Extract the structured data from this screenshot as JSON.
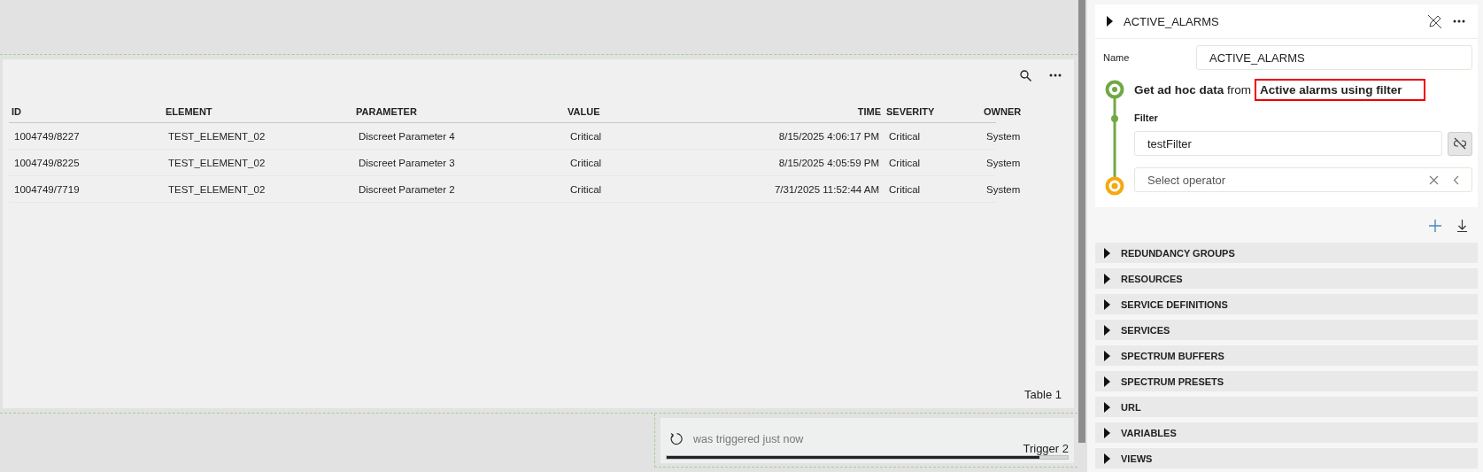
{
  "table_panel": {
    "title": "Table 1",
    "columns": [
      "ID",
      "ELEMENT",
      "PARAMETER",
      "VALUE",
      "TIME",
      "SEVERITY",
      "OWNER"
    ],
    "rows": [
      [
        "1004749/8227",
        "TEST_ELEMENT_02",
        "Discreet Parameter 4",
        "Critical",
        "8/15/2025 4:06:17 PM",
        "Critical",
        "System"
      ],
      [
        "1004749/8225",
        "TEST_ELEMENT_02",
        "Discreet Parameter 3",
        "Critical",
        "8/15/2025 4:05:59 PM",
        "Critical",
        "System"
      ],
      [
        "1004749/7719",
        "TEST_ELEMENT_02",
        "Discreet Parameter 2",
        "Critical",
        "7/31/2025 11:52:44 AM",
        "Critical",
        "System"
      ]
    ]
  },
  "trigger": {
    "title": "Trigger 2",
    "status": "was triggered just now",
    "level": 0.93
  },
  "query": {
    "title": "ACTIVE_ALARMS",
    "expanded": false,
    "name_label": "Name",
    "name_value": "ACTIVE_ALARMS",
    "action": "Get ad hoc data",
    "from": "from",
    "source": "Active alarms using filter",
    "source_highlighted": true,
    "filter_label": "Filter",
    "filter_value": "testFilter",
    "operator_placeholder": "Select operator"
  },
  "sections": [
    {
      "label": "REDUNDANCY GROUPS",
      "expanded": false
    },
    {
      "label": "RESOURCES",
      "expanded": false
    },
    {
      "label": "SERVICE DEFINITIONS",
      "expanded": false
    },
    {
      "label": "SERVICES",
      "expanded": false
    },
    {
      "label": "SPECTRUM BUFFERS",
      "expanded": false
    },
    {
      "label": "SPECTRUM PRESETS",
      "expanded": false
    },
    {
      "label": "URL",
      "expanded": false
    },
    {
      "label": "VARIABLES",
      "expanded": false
    },
    {
      "label": "VIEWS",
      "expanded": false
    }
  ]
}
